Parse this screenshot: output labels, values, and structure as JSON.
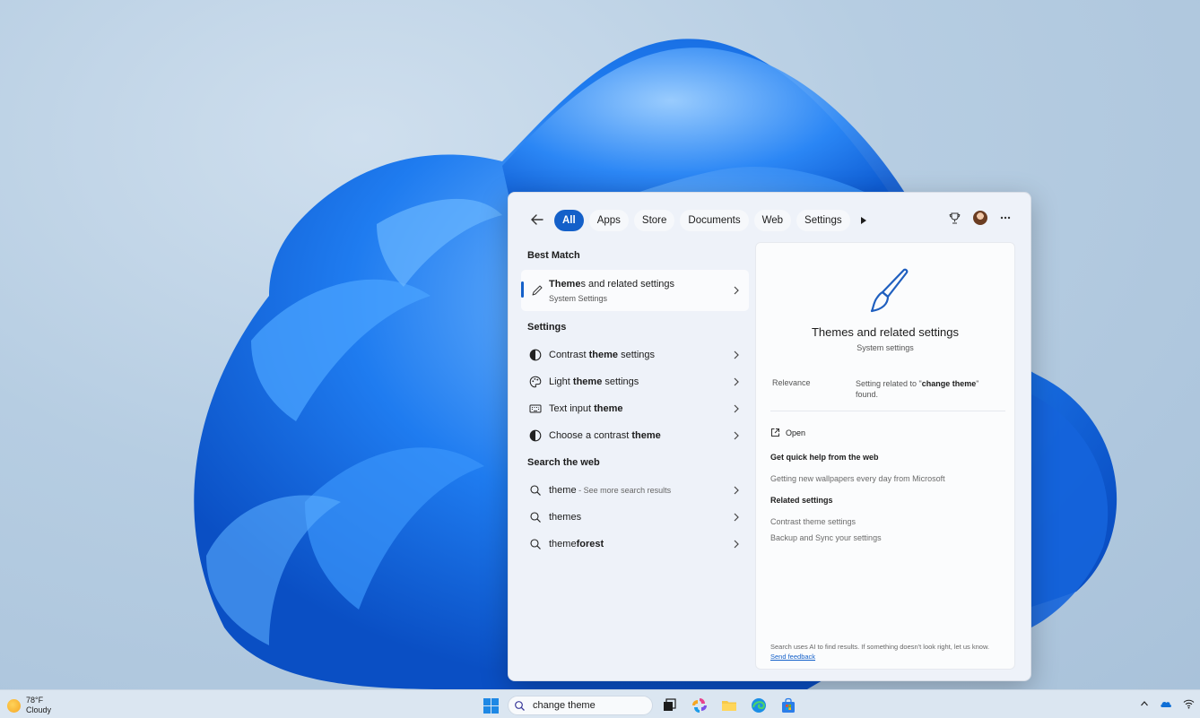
{
  "search_panel": {
    "filters": [
      "All",
      "Apps",
      "Store",
      "Documents",
      "Web",
      "Settings"
    ],
    "active_filter": "All",
    "best_match": {
      "heading": "Best Match",
      "title_bold": "Theme",
      "title_rest": "s and related settings",
      "subtitle": "System Settings"
    },
    "settings": {
      "heading": "Settings",
      "items": [
        {
          "pre": "Contrast ",
          "bold": "theme",
          "post": " settings",
          "icon": "contrast-icon"
        },
        {
          "pre": "Light ",
          "bold": "theme",
          "post": " settings",
          "icon": "palette-icon"
        },
        {
          "pre": "Text input ",
          "bold": "theme",
          "post": "",
          "icon": "keyboard-icon"
        },
        {
          "pre": "Choose a contrast ",
          "bold": "theme",
          "post": "",
          "icon": "contrast-icon"
        }
      ]
    },
    "web": {
      "heading": "Search the web",
      "items": [
        {
          "bold": "theme",
          "rest": "",
          "sub": " - See more search results"
        },
        {
          "bold": "",
          "rest": "themes",
          "sub": ""
        },
        {
          "bold": "theme",
          "rest": "forest",
          "sub": ""
        }
      ]
    },
    "detail": {
      "title": "Themes and related settings",
      "subtitle": "System settings",
      "relevance_label": "Relevance",
      "relevance_pre": "Setting related to \"",
      "relevance_bold": "change theme",
      "relevance_post": "\" found.",
      "open_label": "Open",
      "quick_help_heading": "Get quick help from the web",
      "quick_help_link": "Getting new wallpapers every day from Microsoft",
      "related_heading": "Related settings",
      "related_links": [
        "Contrast theme settings",
        "Backup and Sync your settings"
      ],
      "footer_text": "Search uses AI to find results. If something doesn't look right, let us know.",
      "feedback_link": "Send feedback"
    }
  },
  "taskbar": {
    "weather_temp": "78°F",
    "weather_desc": "Cloudy",
    "search_value": "change theme"
  },
  "colors": {
    "accent": "#1460c9",
    "wallpaper_bloom": "#1a73e8"
  }
}
